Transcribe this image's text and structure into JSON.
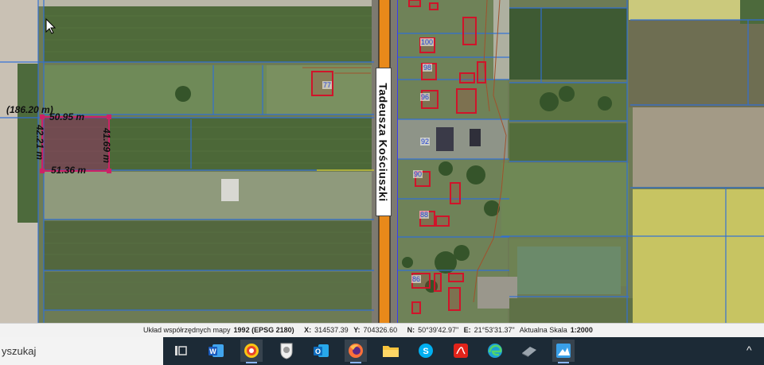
{
  "map": {
    "street_name": "Tadeusza Kościuszki",
    "area_label": "(186.20 m)",
    "dimensions": {
      "top": "50.95 m",
      "bottom": "51.36 m",
      "left": "42.21 m",
      "right": "41.69 m"
    },
    "house_numbers": [
      "77",
      "100",
      "98",
      "96",
      "92",
      "90",
      "88",
      "86"
    ]
  },
  "status": {
    "coord_system_label": "Układ współrzędnych mapy",
    "coord_system_value": "1992 (EPSG 2180)",
    "x_label": "X:",
    "x_value": "314537.39",
    "y_label": "Y:",
    "y_value": "704326.60",
    "n_label": "N:",
    "n_value": "50°39'42.97\"",
    "e_label": "E:",
    "e_value": "21°53'31.37\"",
    "scale_label": "Aktualna Skala",
    "scale_value": "1:2000"
  },
  "taskbar": {
    "search_text": "yszukaj",
    "apps": [
      "task-view",
      "word",
      "browser",
      "emblem",
      "outlook",
      "firefox",
      "file-explorer",
      "skype",
      "pdf",
      "edge",
      "app-gray",
      "app-blue"
    ],
    "tray_chevron": "^"
  },
  "colors": {
    "parcel_line": "#2f6fd8",
    "building": "#d0142a",
    "road": "#e88a1a",
    "measure": "#cc2266"
  }
}
